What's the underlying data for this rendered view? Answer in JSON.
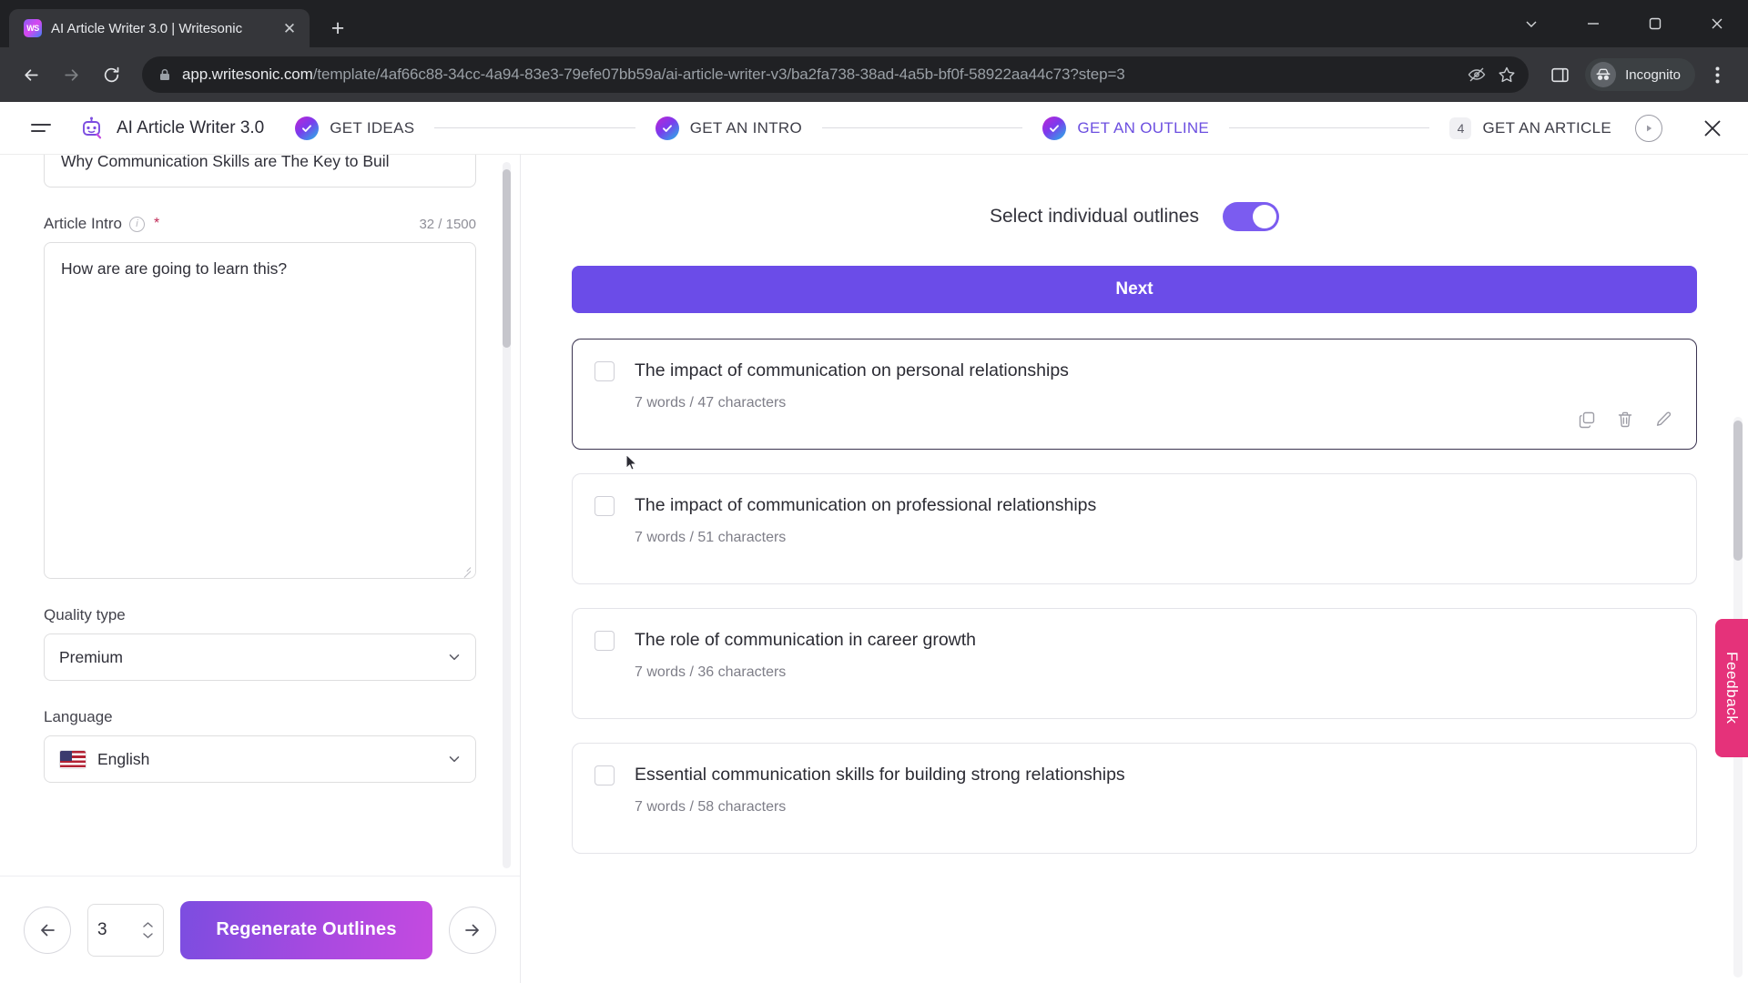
{
  "browser": {
    "tab": {
      "title": "AI Article Writer 3.0 | Writesonic",
      "favicon_text": "WS",
      "favicon_name": "writesonic-favicon",
      "close_label": "✕"
    },
    "new_tab_label": "+",
    "window_controls": [
      "minimize-chevron",
      "minimize",
      "maximize",
      "close"
    ],
    "toolbar": {
      "back_label": "←",
      "forward_label": "→",
      "reload_label": "↻",
      "url_host": "app.writesonic.com",
      "url_path": "/template/4af66c88-34cc-4a94-83e3-79efe07bb59a/ai-article-writer-v3/ba2fa738-38ad-4a5b-bf0f-58922aa44c73?step=3",
      "lock_icon": "lock-icon",
      "eye_icon": "eye-off-icon",
      "bookmark_icon": "star-icon",
      "sidepanel_icon": "side-panel-icon",
      "incognito_label": "Incognito",
      "menu_icon": "kebab-menu-icon"
    }
  },
  "app": {
    "title": "AI Article Writer 3.0",
    "menu_icon": "hamburger-menu-icon",
    "logo_icon": "robot-logo-icon",
    "play_icon": "play-circle-icon",
    "close_icon": "close-icon",
    "steps": [
      {
        "label": "GET IDEAS",
        "state": "done",
        "badge": "check"
      },
      {
        "label": "GET AN INTRO",
        "state": "done",
        "badge": "check"
      },
      {
        "label": "GET AN OUTLINE",
        "state": "active",
        "badge": "check"
      },
      {
        "label": "GET AN ARTICLE",
        "state": "upcoming",
        "badge": "4"
      }
    ],
    "accent_purple": "#6b4ce8",
    "active_step_color": "#6c4fe0"
  },
  "sidebar": {
    "top_field_value": "Why Communication Skills are The Key to Buil",
    "intro": {
      "label": "Article Intro",
      "required_mark": "*",
      "info_icon": "info-icon",
      "counter": "32 / 1500",
      "value": "How are are going to learn this?"
    },
    "quality": {
      "label": "Quality type",
      "value": "Premium",
      "chevron_icon": "chevron-down-icon"
    },
    "language": {
      "label": "Language",
      "value": "English",
      "flag_icon": "us-flag-icon",
      "chevron_icon": "chevron-down-icon"
    },
    "footer": {
      "back_icon": "arrow-left-icon",
      "forward_icon": "arrow-right-icon",
      "count_value": "3",
      "regenerate_label": "Regenerate Outlines"
    }
  },
  "outlines_panel": {
    "toggle_label": "Select individual outlines",
    "toggle_on": true,
    "next_label": "Next",
    "cards": [
      {
        "title": "The impact of communication on personal relationships",
        "meta": "7 words / 47 characters",
        "selected": true,
        "checked": false,
        "actions": [
          "copy-icon",
          "delete-icon",
          "edit-icon"
        ]
      },
      {
        "title": "The impact of communication on professional relationships",
        "meta": "7 words / 51 characters",
        "selected": false,
        "checked": false,
        "actions": []
      },
      {
        "title": "The role of communication in career growth",
        "meta": "7 words / 36 characters",
        "selected": false,
        "checked": false,
        "actions": []
      },
      {
        "title": "Essential communication skills for building strong relationships",
        "meta": "7 words / 58 characters",
        "selected": false,
        "checked": false,
        "actions": []
      }
    ]
  },
  "feedback": {
    "label": "Feedback",
    "color": "#e5327a"
  }
}
